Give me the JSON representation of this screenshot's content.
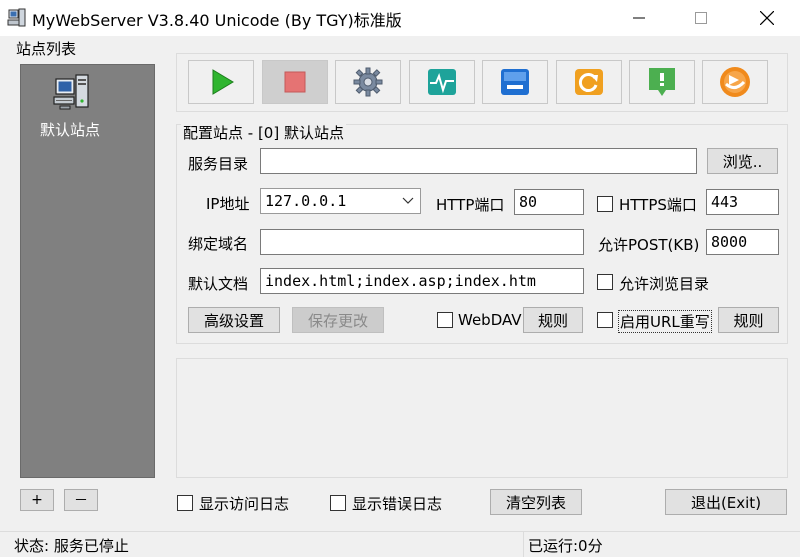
{
  "window": {
    "title": "MyWebServer V3.8.40 Unicode (By TGY)标准版"
  },
  "sites": {
    "group_label": "站点列表",
    "items": [
      {
        "label": "默认站点",
        "icon": "server-computer-icon"
      }
    ],
    "add_label": "+",
    "remove_label": "－"
  },
  "toolbar": {
    "buttons": [
      {
        "name": "start",
        "icon": "play-icon",
        "color": "#2fb52f"
      },
      {
        "name": "stop",
        "icon": "stop-icon",
        "color": "#e57373"
      },
      {
        "name": "settings",
        "icon": "gear-icon",
        "color": "#6f7f95"
      },
      {
        "name": "monitor",
        "icon": "pulse-icon",
        "color": "#1ea39a"
      },
      {
        "name": "window",
        "icon": "window-icon",
        "color": "#1f6fd1"
      },
      {
        "name": "refresh",
        "icon": "refresh-icon",
        "color": "#f0a020"
      },
      {
        "name": "download",
        "icon": "download-icon",
        "color": "#4caf50"
      },
      {
        "name": "about",
        "icon": "clock-icon",
        "color": "#f08a1c"
      }
    ]
  },
  "config": {
    "group_label": "配置站点 - [0] 默认站点",
    "service_dir_label": "服务目录",
    "service_dir_value": "",
    "browse_label": "浏览..",
    "ip_label": "IP地址",
    "ip_value": "127.0.0.1",
    "http_port_label": "HTTP端口",
    "http_port_value": "80",
    "https_port_label": "HTTPS端口",
    "https_port_value": "443",
    "https_checked": false,
    "domain_label": "绑定域名",
    "domain_value": "",
    "post_label": "允许POST(KB)",
    "post_value": "8000",
    "default_doc_label": "默认文档",
    "default_doc_value": "index.html;index.asp;index.htm",
    "browse_dir_label": "允许浏览目录",
    "browse_dir_checked": false,
    "advanced_label": "高级设置",
    "save_label": "保存更改",
    "webdav_label": "WebDAV",
    "webdav_checked": false,
    "webdav_rule_label": "规则",
    "url_rewrite_label": "启用URL重写",
    "url_rewrite_checked": false,
    "rewrite_rule_label": "规则"
  },
  "footer": {
    "show_access_log_label": "显示访问日志",
    "show_error_log_label": "显示错误日志",
    "clear_list_label": "清空列表",
    "exit_label": "退出(Exit)"
  },
  "status": {
    "left": "状态: 服务已停止",
    "right": "已运行:0分"
  }
}
